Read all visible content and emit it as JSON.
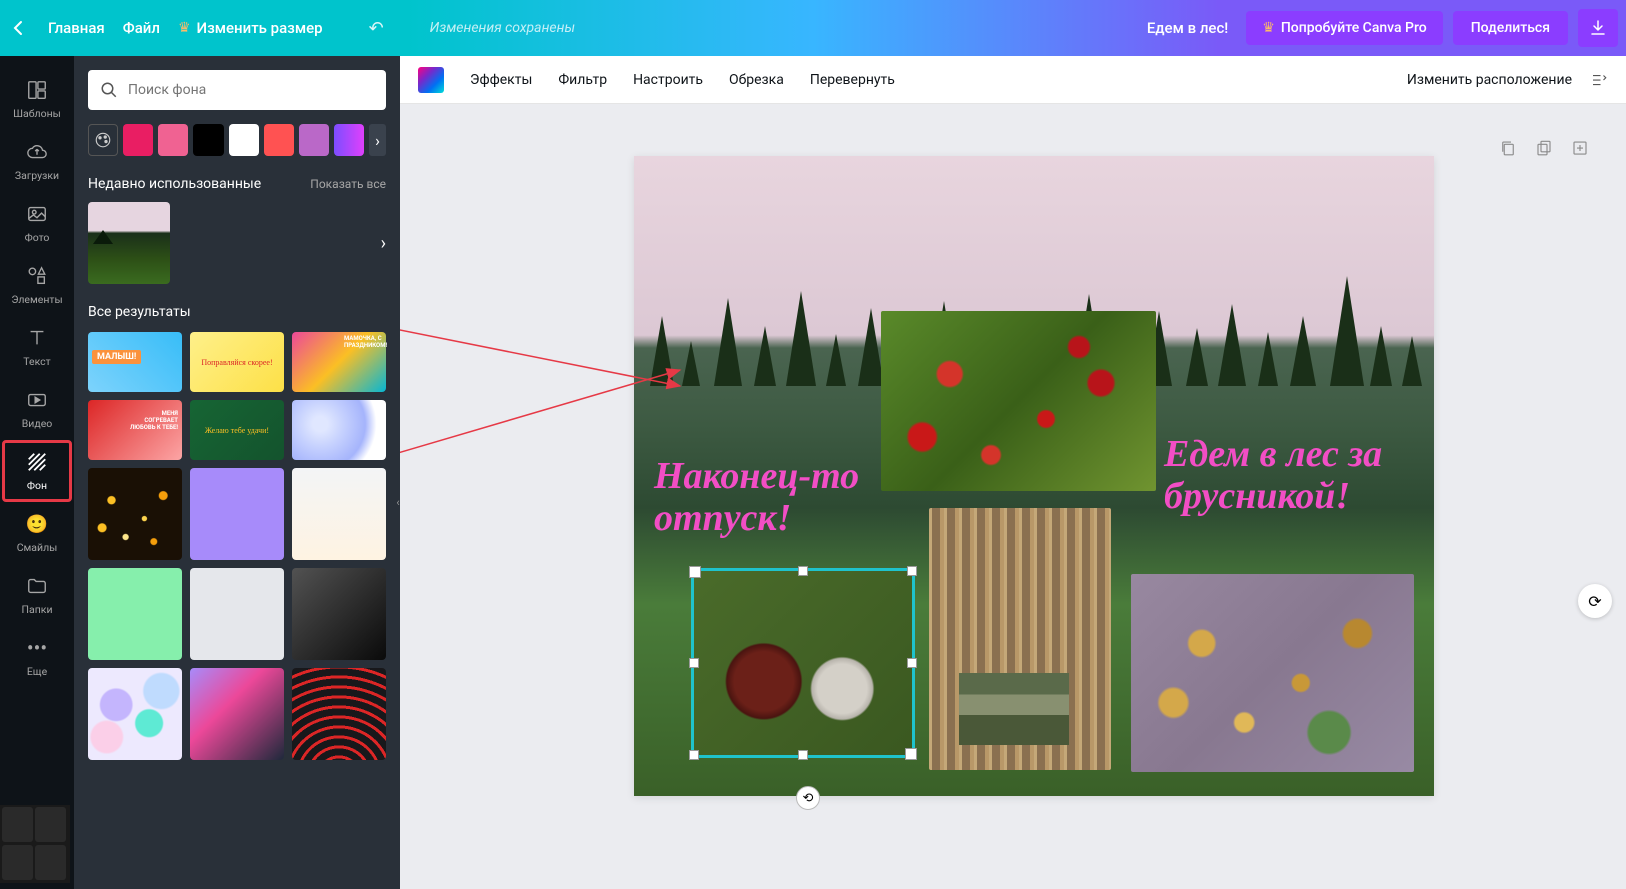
{
  "header": {
    "home": "Главная",
    "file": "Файл",
    "resize": "Изменить размер",
    "saved": "Изменения сохранены",
    "doc_title": "Едем в лес!",
    "try_pro": "Попробуйте Canva Pro",
    "share": "Поделиться"
  },
  "sidebar": {
    "items": [
      {
        "label": "Шаблоны"
      },
      {
        "label": "Загрузки"
      },
      {
        "label": "Фото"
      },
      {
        "label": "Элементы"
      },
      {
        "label": "Текст"
      },
      {
        "label": "Видео"
      },
      {
        "label": "Фон"
      },
      {
        "label": "Смайлы"
      },
      {
        "label": "Папки"
      },
      {
        "label": "Еще"
      }
    ]
  },
  "panel": {
    "search_placeholder": "Поиск фона",
    "colors": [
      "#e91e63",
      "#f06292",
      "#000000",
      "#ffffff",
      "#ff5252",
      "#ba68c8",
      "linear-gradient(90deg,#7c4dff,#e040fb)"
    ],
    "recent_title": "Недавно использованные",
    "show_all": "Показать все",
    "all_title": "Все результаты",
    "thumb_text_2": "Поправляйся скорее!",
    "thumb_text_5": "Желаю тебе удачи!"
  },
  "toolbar": {
    "effects": "Эффекты",
    "filter": "Фильтр",
    "adjust": "Настроить",
    "crop": "Обрезка",
    "flip": "Перевернуть",
    "arrange": "Изменить расположение"
  },
  "canvas": {
    "text1": "Наконец-то отпуск!",
    "text2": "Едем в лес за брусникой!"
  }
}
